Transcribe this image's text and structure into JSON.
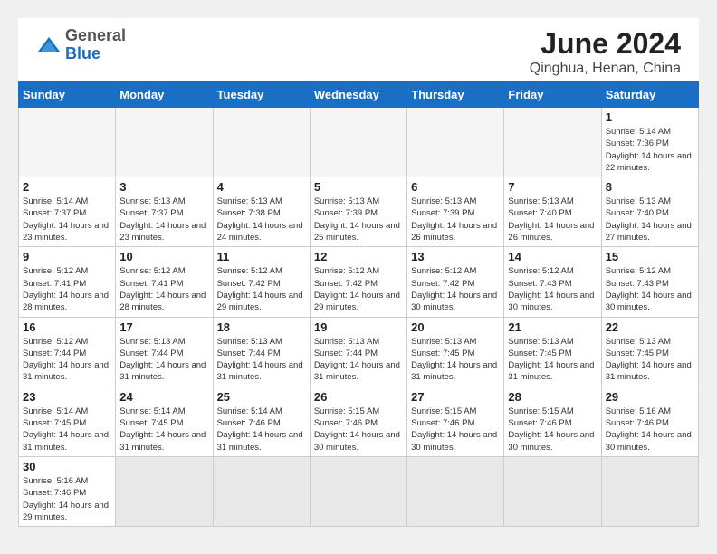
{
  "header": {
    "logo_general": "General",
    "logo_blue": "Blue",
    "title": "June 2024",
    "subtitle": "Qinghua, Henan, China"
  },
  "days_of_week": [
    "Sunday",
    "Monday",
    "Tuesday",
    "Wednesday",
    "Thursday",
    "Friday",
    "Saturday"
  ],
  "weeks": [
    [
      {
        "day": "",
        "info": "",
        "empty": true
      },
      {
        "day": "",
        "info": "",
        "empty": true
      },
      {
        "day": "",
        "info": "",
        "empty": true
      },
      {
        "day": "",
        "info": "",
        "empty": true
      },
      {
        "day": "",
        "info": "",
        "empty": true
      },
      {
        "day": "",
        "info": "",
        "empty": true
      },
      {
        "day": "1",
        "info": "Sunrise: 5:14 AM\nSunset: 7:36 PM\nDaylight: 14 hours\nand 22 minutes."
      }
    ],
    [
      {
        "day": "2",
        "info": "Sunrise: 5:14 AM\nSunset: 7:37 PM\nDaylight: 14 hours\nand 23 minutes."
      },
      {
        "day": "3",
        "info": "Sunrise: 5:13 AM\nSunset: 7:37 PM\nDaylight: 14 hours\nand 23 minutes."
      },
      {
        "day": "4",
        "info": "Sunrise: 5:13 AM\nSunset: 7:38 PM\nDaylight: 14 hours\nand 24 minutes."
      },
      {
        "day": "5",
        "info": "Sunrise: 5:13 AM\nSunset: 7:39 PM\nDaylight: 14 hours\nand 25 minutes."
      },
      {
        "day": "6",
        "info": "Sunrise: 5:13 AM\nSunset: 7:39 PM\nDaylight: 14 hours\nand 26 minutes."
      },
      {
        "day": "7",
        "info": "Sunrise: 5:13 AM\nSunset: 7:40 PM\nDaylight: 14 hours\nand 26 minutes."
      },
      {
        "day": "8",
        "info": "Sunrise: 5:13 AM\nSunset: 7:40 PM\nDaylight: 14 hours\nand 27 minutes."
      }
    ],
    [
      {
        "day": "9",
        "info": "Sunrise: 5:12 AM\nSunset: 7:41 PM\nDaylight: 14 hours\nand 28 minutes."
      },
      {
        "day": "10",
        "info": "Sunrise: 5:12 AM\nSunset: 7:41 PM\nDaylight: 14 hours\nand 28 minutes."
      },
      {
        "day": "11",
        "info": "Sunrise: 5:12 AM\nSunset: 7:42 PM\nDaylight: 14 hours\nand 29 minutes."
      },
      {
        "day": "12",
        "info": "Sunrise: 5:12 AM\nSunset: 7:42 PM\nDaylight: 14 hours\nand 29 minutes."
      },
      {
        "day": "13",
        "info": "Sunrise: 5:12 AM\nSunset: 7:42 PM\nDaylight: 14 hours\nand 30 minutes."
      },
      {
        "day": "14",
        "info": "Sunrise: 5:12 AM\nSunset: 7:43 PM\nDaylight: 14 hours\nand 30 minutes."
      },
      {
        "day": "15",
        "info": "Sunrise: 5:12 AM\nSunset: 7:43 PM\nDaylight: 14 hours\nand 30 minutes."
      }
    ],
    [
      {
        "day": "16",
        "info": "Sunrise: 5:12 AM\nSunset: 7:44 PM\nDaylight: 14 hours\nand 31 minutes."
      },
      {
        "day": "17",
        "info": "Sunrise: 5:13 AM\nSunset: 7:44 PM\nDaylight: 14 hours\nand 31 minutes."
      },
      {
        "day": "18",
        "info": "Sunrise: 5:13 AM\nSunset: 7:44 PM\nDaylight: 14 hours\nand 31 minutes."
      },
      {
        "day": "19",
        "info": "Sunrise: 5:13 AM\nSunset: 7:44 PM\nDaylight: 14 hours\nand 31 minutes."
      },
      {
        "day": "20",
        "info": "Sunrise: 5:13 AM\nSunset: 7:45 PM\nDaylight: 14 hours\nand 31 minutes."
      },
      {
        "day": "21",
        "info": "Sunrise: 5:13 AM\nSunset: 7:45 PM\nDaylight: 14 hours\nand 31 minutes."
      },
      {
        "day": "22",
        "info": "Sunrise: 5:13 AM\nSunset: 7:45 PM\nDaylight: 14 hours\nand 31 minutes."
      }
    ],
    [
      {
        "day": "23",
        "info": "Sunrise: 5:14 AM\nSunset: 7:45 PM\nDaylight: 14 hours\nand 31 minutes."
      },
      {
        "day": "24",
        "info": "Sunrise: 5:14 AM\nSunset: 7:45 PM\nDaylight: 14 hours\nand 31 minutes."
      },
      {
        "day": "25",
        "info": "Sunrise: 5:14 AM\nSunset: 7:46 PM\nDaylight: 14 hours\nand 31 minutes."
      },
      {
        "day": "26",
        "info": "Sunrise: 5:15 AM\nSunset: 7:46 PM\nDaylight: 14 hours\nand 30 minutes."
      },
      {
        "day": "27",
        "info": "Sunrise: 5:15 AM\nSunset: 7:46 PM\nDaylight: 14 hours\nand 30 minutes."
      },
      {
        "day": "28",
        "info": "Sunrise: 5:15 AM\nSunset: 7:46 PM\nDaylight: 14 hours\nand 30 minutes."
      },
      {
        "day": "29",
        "info": "Sunrise: 5:16 AM\nSunset: 7:46 PM\nDaylight: 14 hours\nand 30 minutes."
      }
    ],
    [
      {
        "day": "30",
        "info": "Sunrise: 5:16 AM\nSunset: 7:46 PM\nDaylight: 14 hours\nand 29 minutes."
      },
      {
        "day": "",
        "info": "",
        "empty": true
      },
      {
        "day": "",
        "info": "",
        "empty": true
      },
      {
        "day": "",
        "info": "",
        "empty": true
      },
      {
        "day": "",
        "info": "",
        "empty": true
      },
      {
        "day": "",
        "info": "",
        "empty": true
      },
      {
        "day": "",
        "info": "",
        "empty": true
      }
    ]
  ]
}
